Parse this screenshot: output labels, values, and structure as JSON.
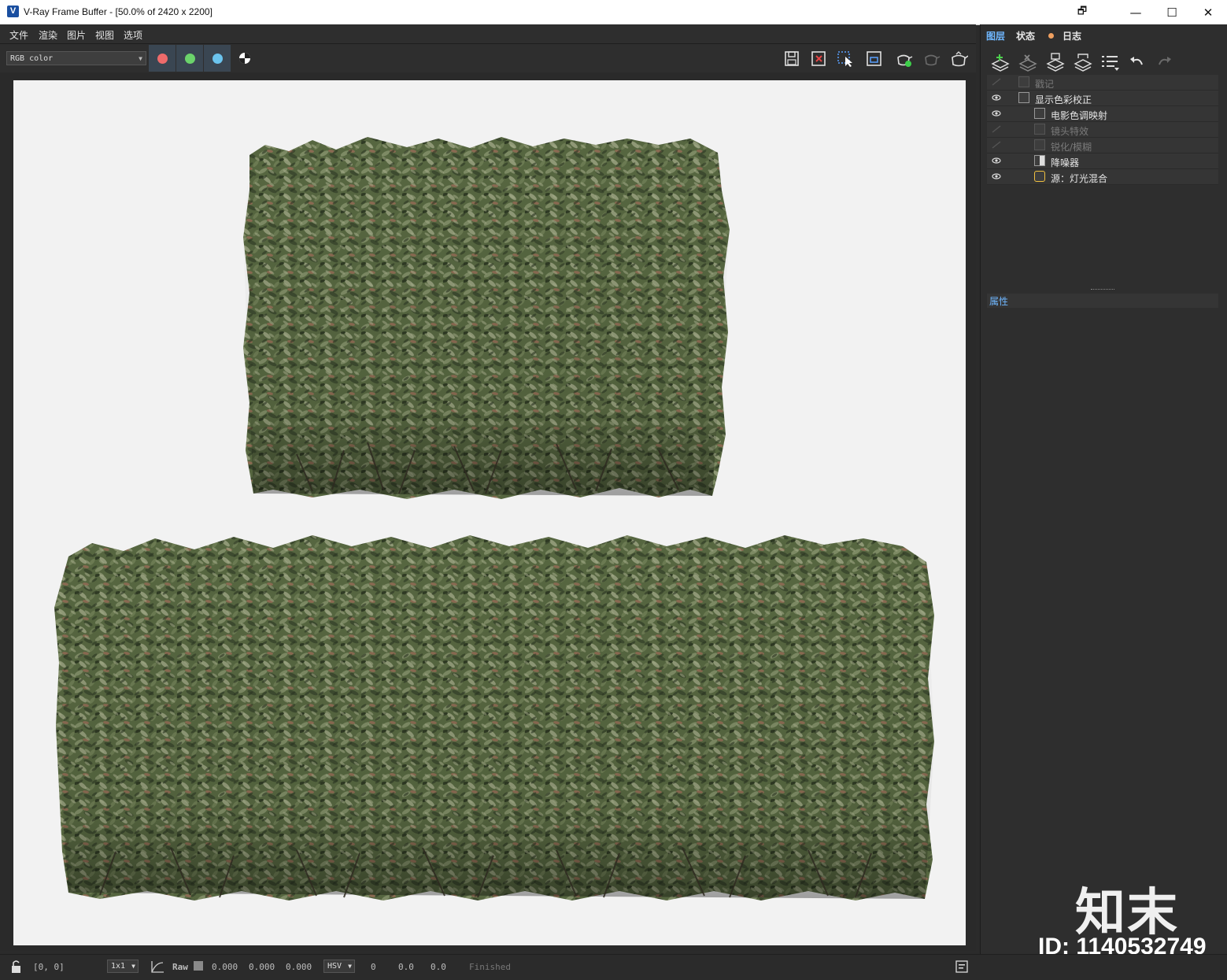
{
  "window": {
    "title": "V-Ray Frame Buffer - [50.0% of 2420 x 2200]",
    "logo_letter": "V",
    "controls": {
      "restore": "🗗",
      "minimize": "—",
      "maximize": "☐",
      "close": "✕"
    }
  },
  "menu": [
    "文件",
    "渲染",
    "图片",
    "视图",
    "选项"
  ],
  "toolbar": {
    "channel": "RGB color",
    "channel_buttons": [
      {
        "name": "red-channel",
        "color": "#ee6b6b"
      },
      {
        "name": "green-channel",
        "color": "#6bd36b"
      },
      {
        "name": "blue-channel",
        "color": "#6bc4ee"
      }
    ],
    "right_icons": [
      "save-image-icon",
      "clear-image-icon",
      "track-mouse-icon",
      "region-render-icon",
      "render-teapot-icon",
      "interactive-render-icon",
      "stop-render-icon"
    ]
  },
  "panel": {
    "tabs": [
      "图层",
      "状态",
      "日志"
    ],
    "active_tab": "图层",
    "log_dot_color": "#f0a060",
    "tool_icons": [
      "add-layer-icon",
      "remove-layer-icon",
      "save-layers-icon",
      "load-layers-icon",
      "layer-list-icon",
      "undo-icon",
      "redo-icon"
    ],
    "layers": [
      {
        "name": "戳记",
        "visible": false,
        "enabled": false,
        "indent": 0
      },
      {
        "name": "显示色彩校正",
        "visible": true,
        "enabled": true,
        "indent": 0
      },
      {
        "name": "电影色调映射",
        "visible": true,
        "enabled": true,
        "indent": 1
      },
      {
        "name": "镜头特效",
        "visible": false,
        "enabled": false,
        "indent": 1
      },
      {
        "name": "锐化/模糊",
        "visible": false,
        "enabled": false,
        "indent": 1
      },
      {
        "name": "降噪器",
        "visible": true,
        "enabled": true,
        "indent": 1
      },
      {
        "name": "源：灯光混合",
        "visible": true,
        "enabled": true,
        "indent": 1
      }
    ],
    "properties_label": "属性"
  },
  "statusbar": {
    "coords": "[0, 0]",
    "sample": "1x1",
    "raw_label": "Raw",
    "raw_values": [
      "0.000",
      "0.000",
      "0.000"
    ],
    "color_mode": "HSV",
    "hsv_values": [
      "0",
      "0.0",
      "0.0"
    ],
    "status": "Finished"
  },
  "watermark": {
    "brand": "知末",
    "id": "ID: 1140532749"
  },
  "colors": {
    "accent": "#6fb7ff",
    "bg": "#2b2b2b",
    "panel": "#2e2e2e",
    "render_bg": "#f2f2f2",
    "foliage_dark": "#3d4a2f",
    "foliage_mid": "#5f7046",
    "foliage_light": "#8a9470",
    "foliage_red": "#8a6a52"
  }
}
